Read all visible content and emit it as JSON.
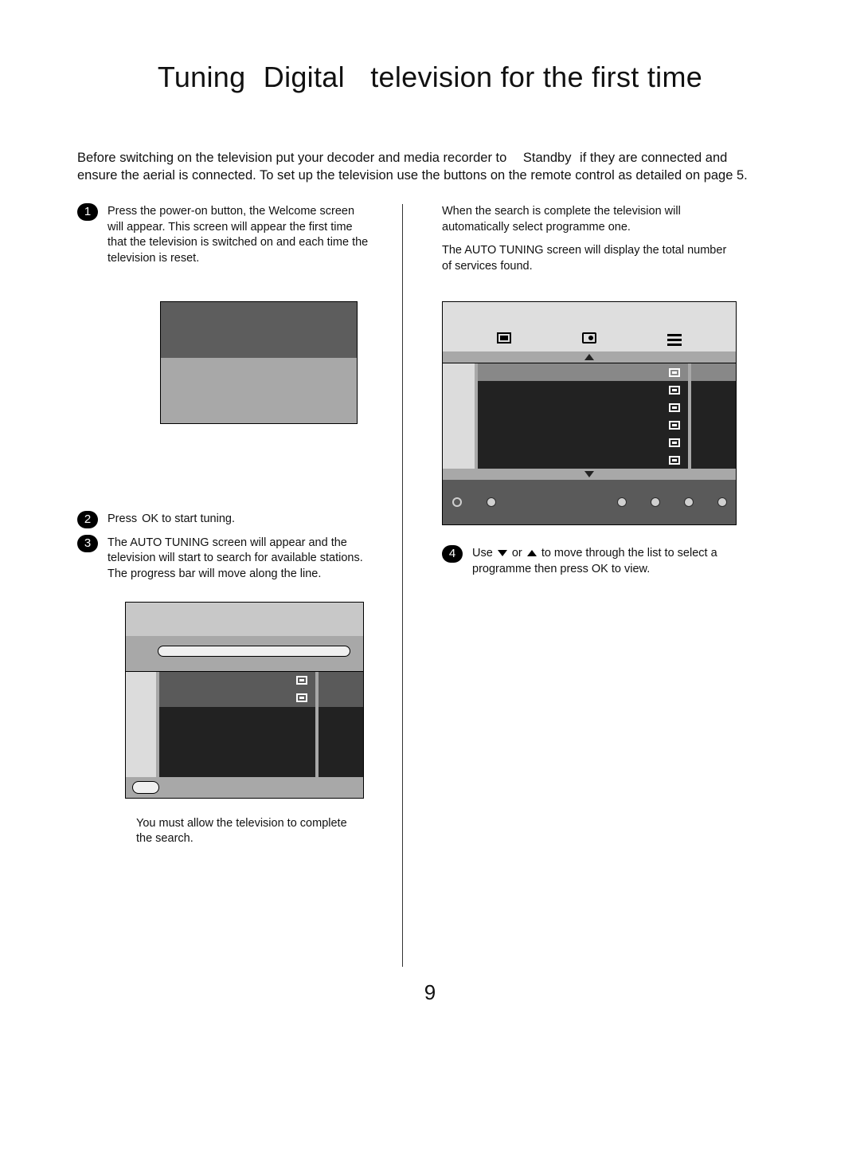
{
  "title_parts": [
    "Tuning",
    "Digital",
    "television for the first time"
  ],
  "intro": {
    "a": "Before switching on the television put your decoder and media recorder to",
    "standby": "Standby",
    "b": "if they are connected and ensure the aerial is connected. To set up the television use the buttons on the remote control as detailed on page 5."
  },
  "steps": {
    "1": "Press the power-on button, the  Welcome  screen will appear. This screen will appear the first time that the television is switched on and each time the television is reset.",
    "2_pre": "Press",
    "2_key": "OK",
    "2_post": " to start tuning.",
    "3": "The AUTO TUNING  screen will appear and the television will start to search for available stations. The progress bar will move along the line.",
    "3_note": "You must allow the television to complete the search.",
    "r1": "When the search is complete the television will automatically select programme one.",
    "r2": "The AUTO TUNING  screen will display the total number of services found.",
    "4_a": "Use ",
    "4_b": " or ",
    "4_c": " to move through the list to select a programme then press  OK  to view."
  },
  "page_num": "9",
  "fig3_rows": [
    {
      "sel": true,
      "tv": true
    },
    {
      "sel": false,
      "tv": true
    },
    {
      "sel": false,
      "tv": true
    },
    {
      "sel": false,
      "tv": true
    },
    {
      "sel": false,
      "tv": true
    },
    {
      "sel": false,
      "tv": true
    }
  ],
  "fig2_rows": [
    {
      "sel": true,
      "tv": true
    },
    {
      "sel": true,
      "tv": true
    },
    {
      "sel": false,
      "tv": false
    },
    {
      "sel": false,
      "tv": false
    },
    {
      "sel": false,
      "tv": false
    },
    {
      "sel": false,
      "tv": false
    }
  ]
}
